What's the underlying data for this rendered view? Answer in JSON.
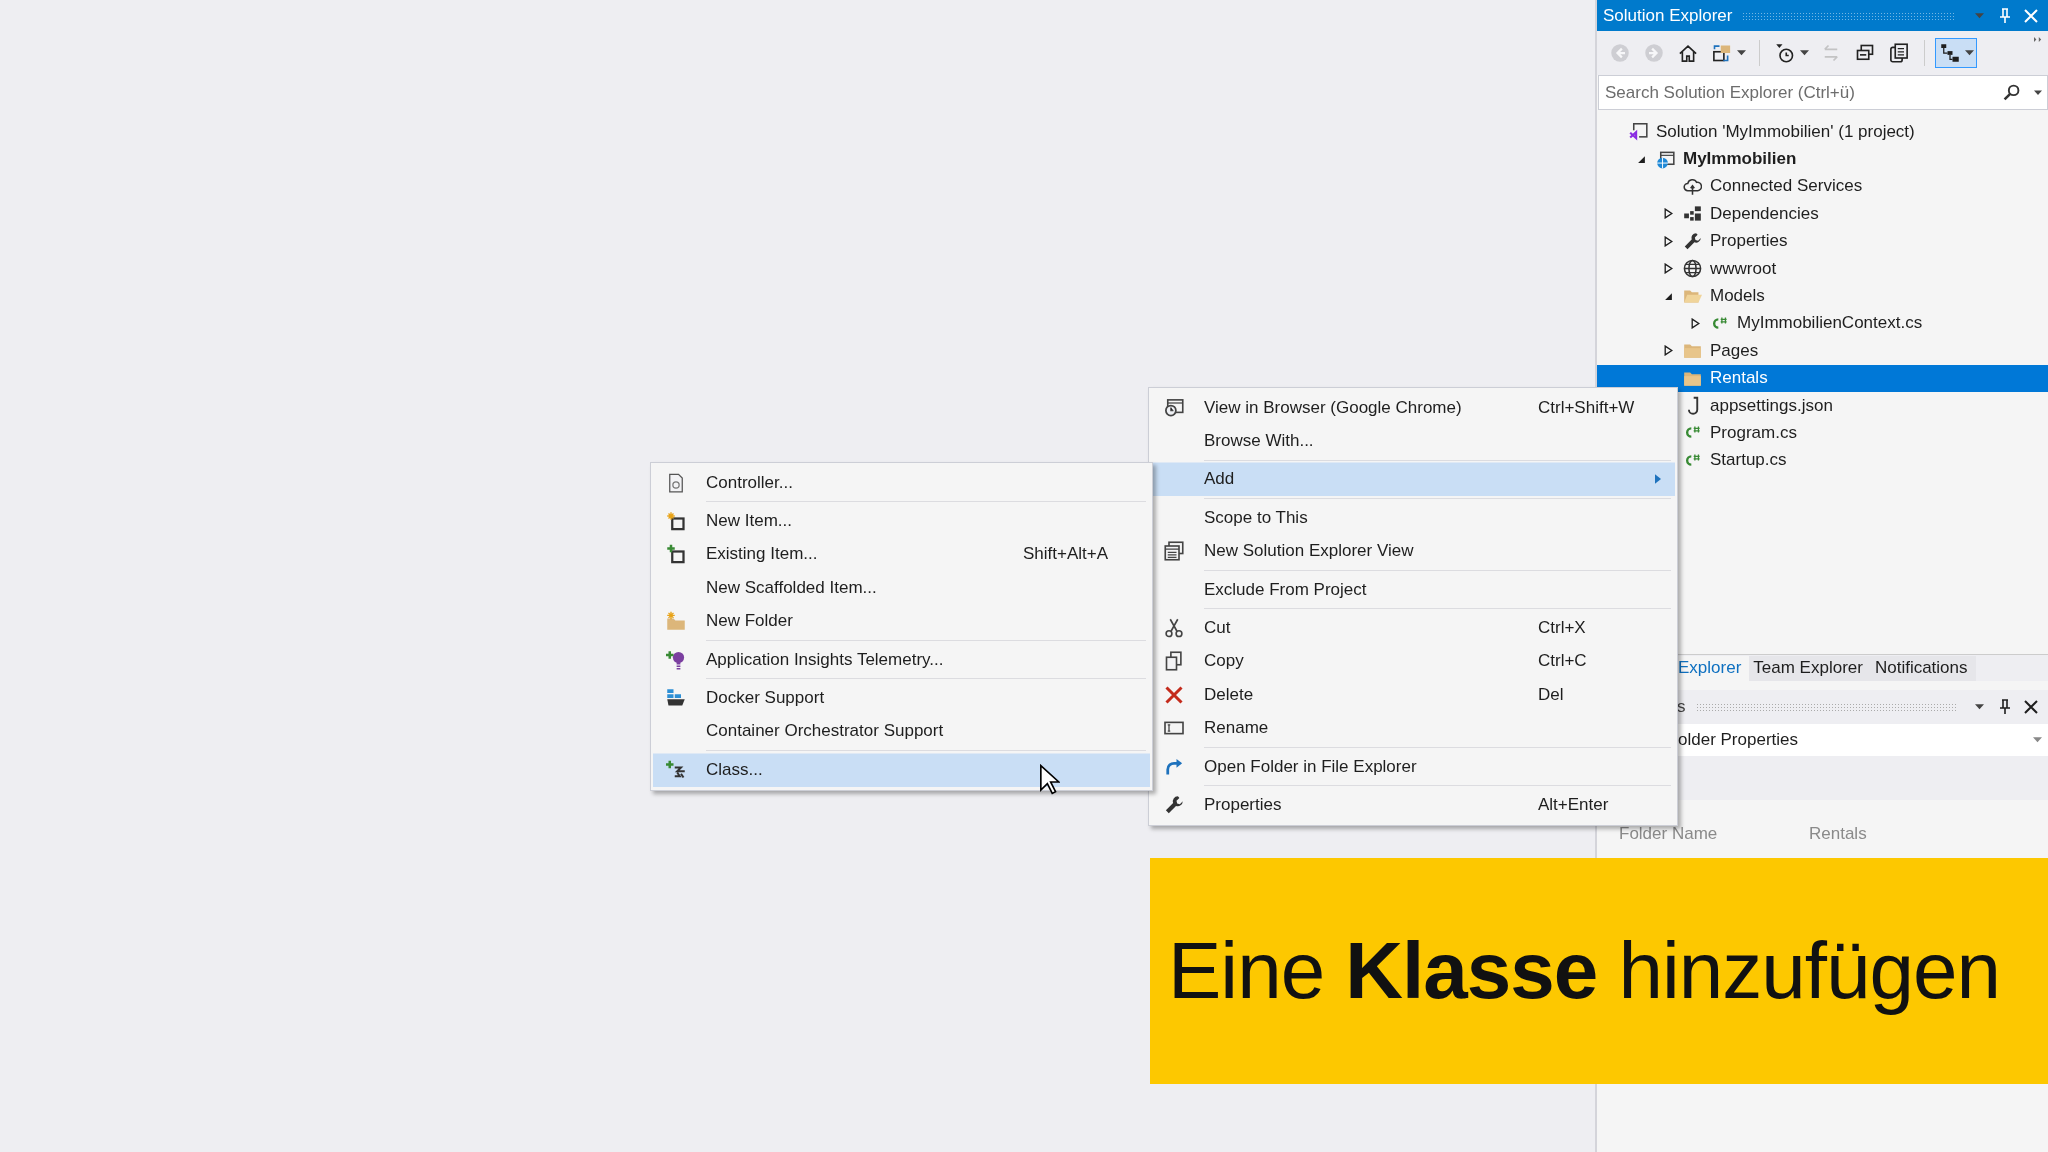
{
  "solution_explorer": {
    "title": "Solution Explorer",
    "toolbar": [
      {
        "kind": "back",
        "disabled": true,
        "on": false,
        "menu": false
      },
      {
        "kind": "forward",
        "disabled": true,
        "on": false,
        "menu": false
      },
      {
        "kind": "home",
        "disabled": false,
        "on": false,
        "menu": false
      },
      {
        "kind": "sync",
        "disabled": false,
        "on": false,
        "menu": true
      },
      {
        "kind": "history",
        "disabled": false,
        "on": false,
        "menu": true
      },
      {
        "kind": "swap",
        "disabled": true,
        "on": false,
        "menu": false
      },
      {
        "kind": "collapse",
        "disabled": false,
        "on": false,
        "menu": false
      },
      {
        "kind": "properties",
        "disabled": false,
        "on": false,
        "menu": false
      },
      {
        "kind": "toggle",
        "disabled": false,
        "on": true,
        "menu": true
      }
    ],
    "search": {
      "placeholder": "Search Solution Explorer (Ctrl+ü)"
    },
    "tree": [
      {
        "label": "Solution 'MyImmobilien' (1 project)",
        "kind": "solution",
        "selected": false,
        "children": [
          {
            "label": "MyImmobilien",
            "kind": "project",
            "expanded": true,
            "selected": false,
            "children": [
              {
                "label": "Connected Services",
                "kind": "cloud",
                "selected": false
              },
              {
                "label": "Dependencies",
                "kind": "deps",
                "expanded": false,
                "selected": false
              },
              {
                "label": "Properties",
                "kind": "wrench",
                "expanded": false,
                "selected": false
              },
              {
                "label": "wwwroot",
                "kind": "globe",
                "expanded": false,
                "selected": false
              },
              {
                "label": "Models",
                "kind": "folder-open",
                "expanded": true,
                "selected": false,
                "children": [
                  {
                    "label": "MyImmobilienContext.cs",
                    "kind": "code",
                    "expanded": false,
                    "selected": false
                  }
                ]
              },
              {
                "label": "Pages",
                "kind": "folder",
                "expanded": false,
                "selected": false
              },
              {
                "label": "Rentals",
                "kind": "folder",
                "selected": true
              },
              {
                "label": "appsettings.json",
                "kind": "json",
                "selected": false
              },
              {
                "label": "Program.cs",
                "kind": "code",
                "selected": false
              },
              {
                "label": "Startup.cs",
                "kind": "code",
                "selected": false
              }
            ]
          }
        ]
      }
    ]
  },
  "bottom_tabs": [
    {
      "label": "Explorer",
      "selected": true
    },
    {
      "label": "Team Explorer",
      "selected": false
    },
    {
      "label": "Notifications",
      "selected": false
    }
  ],
  "properties_panel": {
    "title": "s",
    "object": "older Properties",
    "rows": [
      {
        "name": "Folder Name",
        "value": "Rentals"
      }
    ]
  },
  "context_menu": [
    {
      "kind": "browser",
      "label": "View in Browser (Google Chrome)",
      "shortcut": "Ctrl+Shift+W",
      "separator_before": false,
      "submenu": false,
      "selected": false
    },
    {
      "kind": "plain",
      "label": "Browse With...",
      "separator_before": false,
      "submenu": false,
      "selected": false
    },
    {
      "kind": "plain",
      "label": "Add",
      "separator_before": true,
      "submenu": true,
      "selected": true
    },
    {
      "kind": "plain",
      "label": "Scope to This",
      "separator_before": true,
      "submenu": false,
      "selected": false
    },
    {
      "kind": "new-view",
      "label": "New Solution Explorer View",
      "separator_before": false,
      "submenu": false,
      "selected": false
    },
    {
      "kind": "plain",
      "label": "Exclude From Project",
      "separator_before": true,
      "submenu": false,
      "selected": false
    },
    {
      "kind": "cut",
      "label": "Cut",
      "shortcut": "Ctrl+X",
      "separator_before": true,
      "submenu": false,
      "selected": false
    },
    {
      "kind": "copy",
      "label": "Copy",
      "shortcut": "Ctrl+C",
      "separator_before": false,
      "submenu": false,
      "selected": false
    },
    {
      "kind": "delete",
      "label": "Delete",
      "shortcut": "Del",
      "separator_before": false,
      "submenu": false,
      "selected": false
    },
    {
      "kind": "rename",
      "label": "Rename",
      "separator_before": false,
      "submenu": false,
      "selected": false
    },
    {
      "kind": "open-folder",
      "label": "Open Folder in File Explorer",
      "separator_before": true,
      "submenu": false,
      "selected": false
    },
    {
      "kind": "wrench",
      "label": "Properties",
      "shortcut": "Alt+Enter",
      "separator_before": true,
      "submenu": false,
      "selected": false
    }
  ],
  "add_submenu": [
    {
      "kind": "controller",
      "label": "Controller...",
      "separator_before": false,
      "selected": false
    },
    {
      "kind": "new-item",
      "label": "New Item...",
      "separator_before": true,
      "selected": false
    },
    {
      "kind": "existing-item",
      "label": "Existing Item...",
      "shortcut": "Shift+Alt+A",
      "separator_before": false,
      "selected": false
    },
    {
      "kind": "plain",
      "label": "New Scaffolded Item...",
      "separator_before": false,
      "selected": false
    },
    {
      "kind": "new-folder",
      "label": "New Folder",
      "separator_before": false,
      "selected": false
    },
    {
      "kind": "insights",
      "label": "Application Insights Telemetry...",
      "separator_before": true,
      "selected": false
    },
    {
      "kind": "docker",
      "label": "Docker Support",
      "separator_before": true,
      "selected": false
    },
    {
      "kind": "plain",
      "label": "Container Orchestrator Support",
      "separator_before": false,
      "selected": false
    },
    {
      "kind": "class",
      "label": "Class...",
      "separator_before": true,
      "selected": true
    }
  ],
  "caption_banner": {
    "text": "Eine **Klasse** hinzufügen"
  }
}
